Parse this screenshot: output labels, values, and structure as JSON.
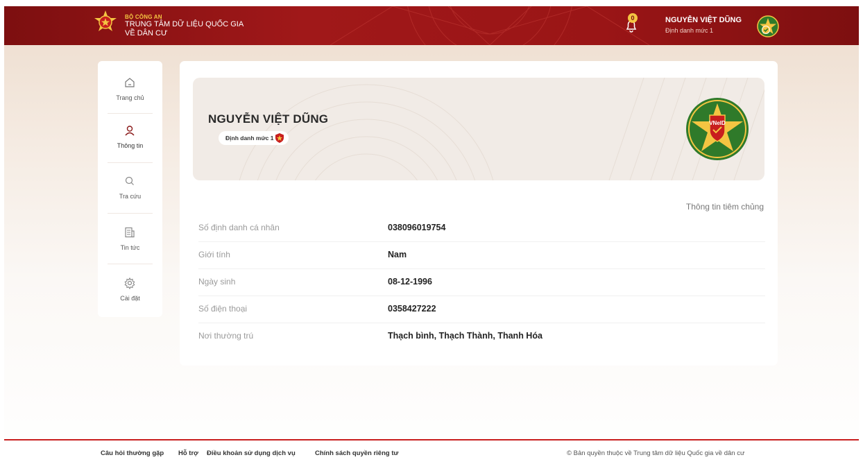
{
  "header": {
    "org_line1": "BỘ CÔNG AN",
    "org_line2": "TRUNG TÂM DỮ LIỆU QUỐC GIA",
    "org_line3": "VỀ DÂN CƯ",
    "notification_count": "0",
    "user_name": "NGUYỄN VIỆT DŨNG",
    "user_level": "Định danh mức 1"
  },
  "sidebar": {
    "items": [
      {
        "label": "Trang chủ",
        "icon": "home-icon"
      },
      {
        "label": "Thông tin",
        "icon": "user-icon"
      },
      {
        "label": "Tra cứu",
        "icon": "search-icon"
      },
      {
        "label": "Tin tức",
        "icon": "news-icon"
      },
      {
        "label": "Cài đặt",
        "icon": "gear-icon"
      }
    ]
  },
  "profile": {
    "name": "NGUYỄN VIỆT DŨNG",
    "level": "Định danh mức 1",
    "logo_text": "VNeID",
    "vaccination_link": "Thông tin tiêm chủng",
    "fields": [
      {
        "label": "Số định danh cá nhân",
        "value": "038096019754"
      },
      {
        "label": "Giới tính",
        "value": "Nam"
      },
      {
        "label": "Ngày sinh",
        "value": "08-12-1996"
      },
      {
        "label": "Số điện thoại",
        "value": "0358427222"
      },
      {
        "label": "Nơi thường trú",
        "value": "Thạch bình, Thạch Thành, Thanh Hóa"
      }
    ]
  },
  "footer": {
    "links": [
      "Câu hỏi thường gặp",
      "Hỗ trợ",
      "Điều khoản sử dụng dịch vụ",
      "Chính sách quyền riêng tư"
    ],
    "copyright": "© Bản quyền thuộc về Trung tâm dữ liệu Quốc gia về dân cư"
  },
  "colors": {
    "header_red": "#9a1516",
    "accent_gold": "#f4c542",
    "footer_line": "#c81e1e",
    "emblem_green": "#2f7a2a"
  }
}
